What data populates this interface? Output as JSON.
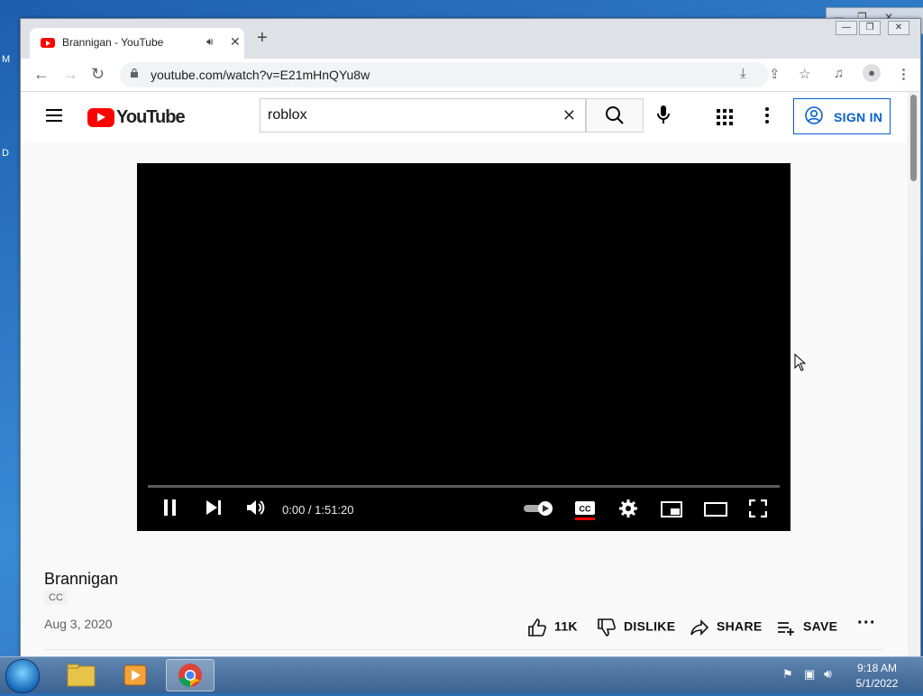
{
  "desktop": {
    "letter_top": "M",
    "letter_mid": "D"
  },
  "browser": {
    "tab_title": "Brannigan - YouTube",
    "url": "youtube.com/watch?v=E21mHnQYu8w"
  },
  "youtube": {
    "logo_text": "YouTube",
    "search": {
      "value": "roblox",
      "placeholder": "Search"
    },
    "sign_in_label": "SIGN IN",
    "player": {
      "time_display": "0:00 / 1:51:20",
      "progress_fraction": 0.0,
      "autoplay_on": true,
      "captions_on": true
    },
    "video": {
      "title": "Brannigan",
      "badge": "CC",
      "date": "Aug 3, 2020",
      "likes": "11K",
      "dislike_label": "DISLIKE",
      "share_label": "SHARE",
      "save_label": "SAVE"
    }
  },
  "taskbar": {
    "time": "9:18 AM",
    "date": "5/1/2022"
  },
  "colors": {
    "youtube_red": "#ff0000",
    "link_blue": "#065fd4",
    "player_bg": "#000000"
  }
}
